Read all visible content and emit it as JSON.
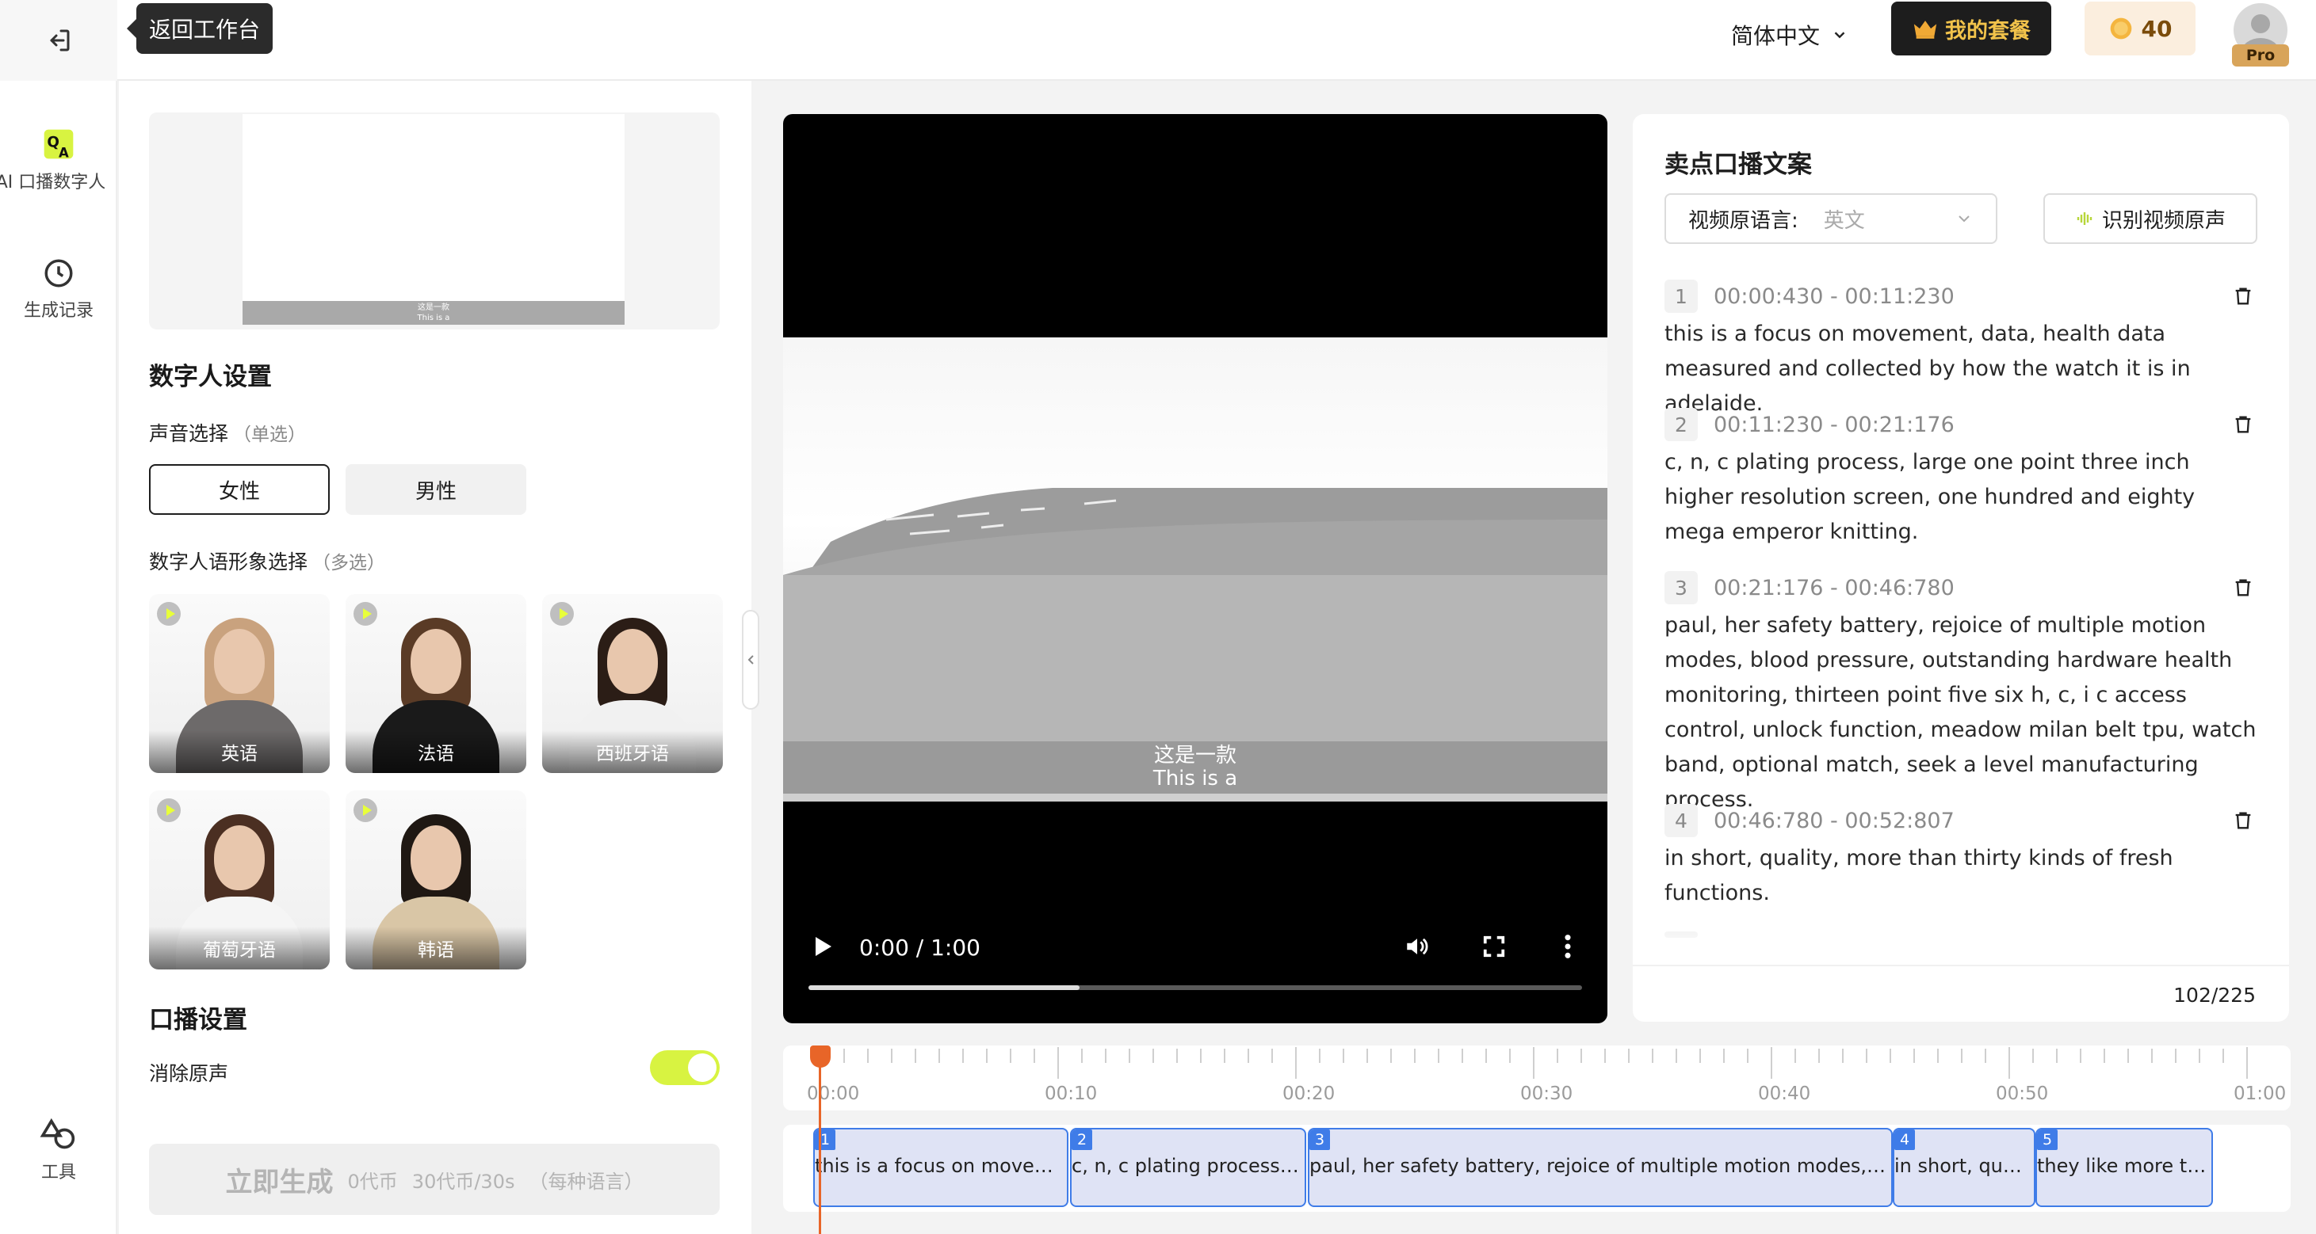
{
  "topbar": {
    "back_tooltip": "返回工作台",
    "language": "简体中文",
    "plan_label": "我的套餐",
    "coins": "40",
    "pro_badge": "Pro"
  },
  "nav": {
    "items": [
      {
        "label": "AI 口播数字人",
        "icon": "ai-avatar-icon"
      },
      {
        "label": "生成记录",
        "icon": "clock-icon"
      },
      {
        "label": "工具",
        "icon": "tools-icon"
      }
    ]
  },
  "preview": {
    "caption_cn": "这是一款",
    "caption_en": "This is a"
  },
  "settings": {
    "title": "数字人设置",
    "voice_label": "声音选择",
    "voice_hint": "（单选）",
    "genders": [
      "女性",
      "男性"
    ],
    "selected_gender": "女性",
    "avatar_label": "数字人语形象选择",
    "avatar_hint": "（多选）",
    "avatars": [
      {
        "label": "英语",
        "hair": "#c9a27e",
        "body": "#6d6a6a"
      },
      {
        "label": "法语",
        "hair": "#5a3b26",
        "body": "#1a1a1a"
      },
      {
        "label": "西班牙语",
        "hair": "#2b1d16",
        "body": "#f1f1f1"
      },
      {
        "label": "葡萄牙语",
        "hair": "#4b2f22",
        "body": "#f5f5f5"
      },
      {
        "label": "韩语",
        "hair": "#1f1813",
        "body": "#d9c6a6"
      }
    ],
    "broadcast_title": "口播设置",
    "remove_voice_label": "消除原声",
    "remove_voice_on": true
  },
  "generate": {
    "label": "立即生成",
    "cost": "0代币",
    "rate": "30代币/30s",
    "note": "（每种语言）"
  },
  "video": {
    "caption_cn": "这是一款",
    "caption_en": "This is a",
    "time": "0:00 / 1:00",
    "progress": 0.35
  },
  "script": {
    "title": "卖点口播文案",
    "lang_label": "视频原语言:",
    "lang_value": "英文",
    "recognize_label": "识别视频原声",
    "segments": [
      {
        "num": "1",
        "time": "00:00:430 - 00:11:230",
        "text": "this is a focus on movement, data, health data measured and collected by how the watch it is in adelaide."
      },
      {
        "num": "2",
        "time": "00:11:230 - 00:21:176",
        "text": "c, n, c plating process, large one point three inch higher resolution screen, one hundred and eighty mega emperor knitting."
      },
      {
        "num": "3",
        "time": "00:21:176 - 00:46:780",
        "text": "paul, her safety battery, rejoice of multiple motion modes, blood pressure, outstanding hardware health monitoring, thirteen point five six h, c, i c access control, unlock function, meadow milan belt tpu, watch band, optional match, seek a level manufacturing process."
      },
      {
        "num": "4",
        "time": "00:46:780 - 00:52:807",
        "text": "in short, quality, more than thirty kinds of fresh functions."
      }
    ],
    "char_count": "102/225"
  },
  "timeline": {
    "labels": [
      "00:00",
      "00:10",
      "00:20",
      "00:30",
      "00:40",
      "00:50",
      "01:00"
    ],
    "clips": [
      {
        "num": "1",
        "text": "this is a focus on moveme..."
      },
      {
        "num": "2",
        "text": "c, n, c plating process, l..."
      },
      {
        "num": "3",
        "text": "paul, her safety battery, rejoice of multiple motion modes, bloo..."
      },
      {
        "num": "4",
        "text": "in short, quali..."
      },
      {
        "num": "5",
        "text": "they like more tex..."
      }
    ]
  },
  "colors": {
    "accent_lime": "#d8f341",
    "playhead": "#e86528",
    "clip_border": "#3f7ce8"
  }
}
